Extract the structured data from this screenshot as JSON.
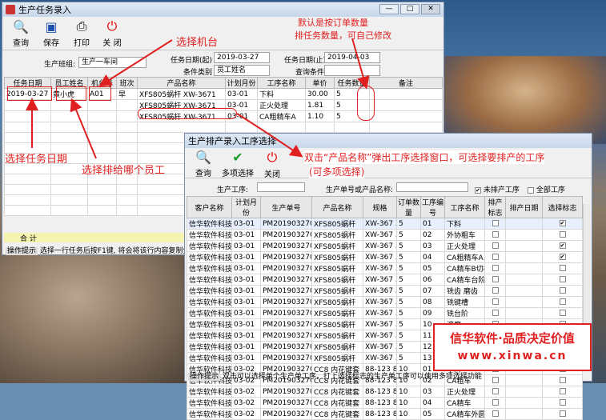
{
  "main_window": {
    "title": "生产任务录入",
    "toolbar": [
      "查询",
      "保存",
      "打印",
      "关 闭"
    ],
    "team_label": "生产班组:",
    "team_value": "生产一车间",
    "date_from_label": "任务日期(起)",
    "date_from": "2019-03-27",
    "date_to_label": "任务日期(止)",
    "date_to": "2019-04-03",
    "cond_type_label": "条件类别",
    "cond_type_value": "员工姓名",
    "query_cond_label": "查询条件",
    "columns": [
      "任务日期",
      "员工姓名",
      "机台号",
      "班次",
      "产品名称",
      "计划月份",
      "工序名称",
      "单价",
      "任务数量",
      "备注"
    ],
    "rows": [
      [
        "2019-03-27",
        "黄小虎",
        "A01",
        "早",
        "XFS805蜗杆",
        "XW-3671",
        "03-01",
        "下料",
        "30.00",
        "5"
      ],
      [
        "",
        "",
        "",
        "",
        "XFS805蜗杆",
        "XW-3671",
        "03-01",
        "正火处理",
        "1.81",
        "5"
      ],
      [
        "",
        "",
        "",
        "",
        "XFS805蜗杆",
        "XW-3671",
        "03-01",
        "CA粗精车A",
        "1.10",
        "5"
      ]
    ],
    "total_label": "合 计",
    "status_label": "操作提示",
    "status_text": "选择一行任务后按F1键, 将会将该行内容复制生成新的"
  },
  "annotations": {
    "select_machine": "选择机台",
    "default_qty_1": "默认是按订单数量",
    "default_qty_2": "排任务数量，可自己修改",
    "select_date": "选择任务日期",
    "select_employee": "选择排给哪个员工",
    "dblclick_1": "双击“产品名称”弹出工序选择窗口，可选择要排产的工序",
    "dblclick_2": "(可多项选择)"
  },
  "popup": {
    "title": "生产排产录入工序选择",
    "toolbar": [
      "查询",
      "多项选择",
      "关闭"
    ],
    "process_label": "生产工序:",
    "order_label": "生产单号或产品名称:",
    "unscheduled_label": "未排产工序",
    "all_label": "全部工序",
    "columns": [
      "客户名称",
      "计划月份",
      "生产单号",
      "产品名称",
      "规格",
      "订单数量",
      "工序编号",
      "工序名称",
      "排产标志",
      "排产日期",
      "选择标志"
    ],
    "rows": [
      [
        "信华软件科技",
        "03-01",
        "PM201903270001",
        "XFS805蜗杆",
        "XW-367",
        "XW-3671",
        "5",
        "01",
        "下料",
        "",
        "checked"
      ],
      [
        "信华软件科技",
        "03-01",
        "PM201903270001",
        "XFS805蜗杆",
        "XW-367",
        "XW-3671",
        "5",
        "02",
        "外协粗车",
        "",
        ""
      ],
      [
        "信华软件科技",
        "03-01",
        "PM201903270001",
        "XFS805蜗杆",
        "XW-367",
        "XW-3671",
        "5",
        "03",
        "正火处理",
        "",
        "checked"
      ],
      [
        "信华软件科技",
        "03-01",
        "PM201903270001",
        "XFS805蜗杆",
        "XW-367",
        "XW-3671",
        "5",
        "04",
        "CA粗精车A",
        "",
        "checked"
      ],
      [
        "信华软件科技",
        "03-01",
        "PM201903270001",
        "XFS805蜗杆",
        "XW-367",
        "XW-3671",
        "5",
        "05",
        "CA精车B切槽",
        "",
        ""
      ],
      [
        "信华软件科技",
        "03-01",
        "PM201903270001",
        "XFS805蜗杆",
        "XW-367",
        "XW-3671",
        "5",
        "06",
        "CA精车台阶外",
        "",
        ""
      ],
      [
        "信华软件科技",
        "03-01",
        "PM201903270001",
        "XFS805蜗杆",
        "XW-367",
        "XW-3671",
        "5",
        "07",
        "铣齿 磨齿",
        "",
        ""
      ],
      [
        "信华软件科技",
        "03-01",
        "PM201903270001",
        "XFS805蜗杆",
        "XW-367",
        "XW-3671",
        "5",
        "08",
        "铣键槽",
        "",
        ""
      ],
      [
        "信华软件科技",
        "03-01",
        "PM201903270001",
        "XFS805蜗杆",
        "XW-367",
        "XW-3671",
        "5",
        "09",
        "铣台阶",
        "",
        ""
      ],
      [
        "信华软件科技",
        "03-01",
        "PM201903270001",
        "XFS805蜗杆",
        "XW-367",
        "XW-3671",
        "5",
        "10",
        "滚磨",
        "",
        ""
      ],
      [
        "信华软件科技",
        "03-01",
        "PM201903270001",
        "XFS805蜗杆",
        "XW-367",
        "XW-3671",
        "5",
        "11",
        "去毛刺",
        "",
        ""
      ],
      [
        "信华软件科技",
        "03-01",
        "PM201903270001",
        "XFS805蜗杆",
        "XW-367",
        "XW-3671",
        "5",
        "12",
        "磨外元",
        "",
        ""
      ],
      [
        "信华软件科技",
        "03-01",
        "PM201903270001",
        "XFS805蜗杆",
        "XW-367",
        "XW-3671",
        "5",
        "13",
        "成品检验",
        "",
        ""
      ],
      [
        "信华软件科技",
        "03-02",
        "PM201903270002",
        "CC8 内花键套",
        "88-123",
        "88-1238",
        "10",
        "01",
        "下料",
        "",
        ""
      ],
      [
        "信华软件科技",
        "03-02",
        "PM201903270002",
        "CC8 内花键套",
        "88-123",
        "88-1238",
        "10",
        "02",
        "CA粗车",
        "",
        ""
      ],
      [
        "信华软件科技",
        "03-02",
        "PM201903270002",
        "CC8 内花键套",
        "88-123",
        "88-1238",
        "10",
        "03",
        "正火处理",
        "",
        ""
      ],
      [
        "信华软件科技",
        "03-02",
        "PM201903270002",
        "CC8 内花键套",
        "88-123",
        "88-1238",
        "10",
        "04",
        "CA精车",
        "",
        ""
      ],
      [
        "信华软件科技",
        "03-02",
        "PM201903270002",
        "CC8 内花键套",
        "88-123",
        "88-1238",
        "10",
        "05",
        "CA精车外圆",
        "",
        ""
      ]
    ],
    "status_label": "操作提示",
    "status_text": "双击可以选择单个生产单工序，打上选择标志的生产单工序可以使用多项选择功能"
  },
  "brand": {
    "line1": "信华软件·品质决定价值",
    "line2": "www.xinwa.cn"
  },
  "colors": {
    "annotation": "#e02020",
    "accent_row": "#0a3a8a"
  }
}
